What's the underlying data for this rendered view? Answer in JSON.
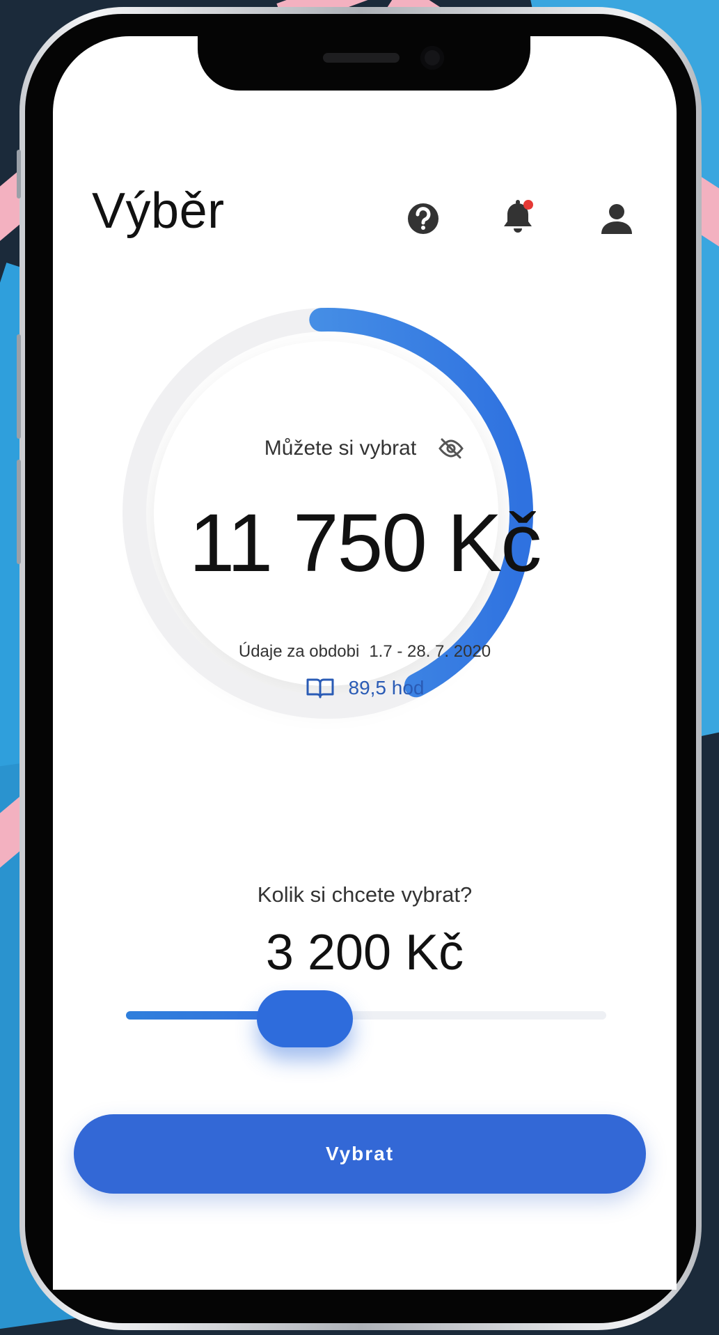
{
  "header": {
    "title": "Výběr"
  },
  "icons": {
    "help": "help-icon",
    "notifications": "bell-icon",
    "profile": "user-icon",
    "visibility": "eye-off-icon",
    "hours": "book-icon"
  },
  "balance": {
    "label": "Můžete si vybrat",
    "amount": "11 750 Kč",
    "period_label": "Údaje za obdobi",
    "period_value": "1.7 - 28. 7. 2020",
    "hours": "89,5 hod",
    "ring_progress": 0.43
  },
  "withdraw": {
    "question": "Kolik si chcete vybrat?",
    "amount": "3 200 Kč",
    "slider_fraction": 0.3,
    "button_label": "Vybrat"
  },
  "colors": {
    "accent": "#3368d6",
    "ring_start": "#5aa8ea",
    "ring_end": "#2f72e0",
    "notification_dot": "#e53935",
    "link": "#2a5bb5"
  }
}
